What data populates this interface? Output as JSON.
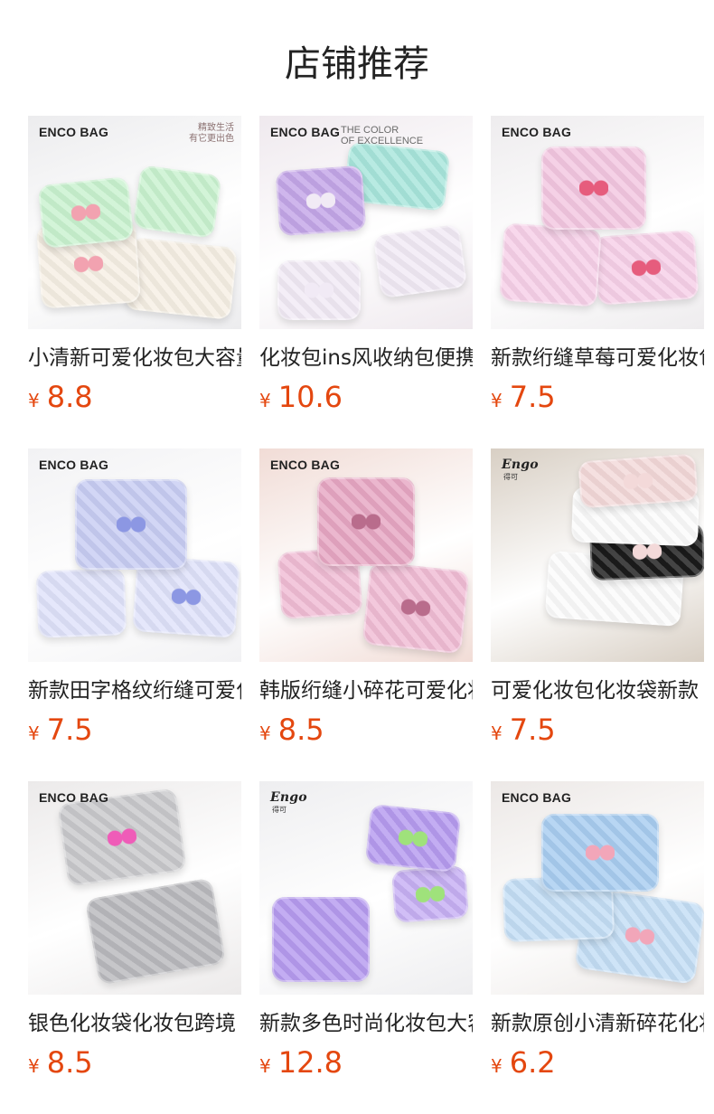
{
  "section_title": "店铺推荐",
  "currency_symbol": "¥",
  "products": [
    {
      "brand": "ENCO BAG",
      "overlay": [
        "精致生活",
        "有它更出色"
      ],
      "name": "小清新可爱化妆包大容量",
      "price": "8.8",
      "palette": {
        "bg": "#ececee",
        "a": "#c9f2cf",
        "b": "#f6efe4",
        "accent": "#f2a2b0",
        "accent2": "#9fb8e8"
      }
    },
    {
      "brand": "ENCO BAG",
      "overlay": [
        "THE COLOR",
        "OF EXCELLENCE"
      ],
      "name": "化妆包ins风收纳包便携",
      "price": "10.6",
      "palette": {
        "bg": "#efe9ee",
        "a": "#c4a6e8",
        "b": "#a8e6dc",
        "accent": "#f1eaf5",
        "accent2": "#f06c9a"
      }
    },
    {
      "brand": "ENCO BAG",
      "overlay": [],
      "name": "新款绗缝草莓可爱化妆包",
      "price": "7.5",
      "palette": {
        "bg": "#eeecee",
        "a": "#f3c7e1",
        "b": "#f7d0e8",
        "accent": "#e65c7d",
        "accent2": "#d8c7a0"
      }
    },
    {
      "brand": "ENCO BAG",
      "overlay": [],
      "name": "新款田字格纹绗缝可爱化妆包",
      "price": "7.5",
      "palette": {
        "bg": "#f2f2f4",
        "a": "#c8cdf3",
        "b": "#dfe2fa",
        "accent": "#8c97e3",
        "accent2": "#f0e6d4"
      }
    },
    {
      "brand": "ENCO BAG",
      "overlay": [],
      "name": "韩版绗缝小碎花可爱化妆包",
      "price": "8.5",
      "palette": {
        "bg": "#f1dcd6",
        "a": "#e7a7c3",
        "b": "#f0bcd4",
        "accent": "#b96c8c",
        "accent2": "#e8d2c4"
      }
    },
    {
      "brand": "Engo",
      "overlay": [
        "得可"
      ],
      "name": "可爱化妆包化妆袋新款",
      "price": "7.5",
      "palette": {
        "bg": "#d8cfc4",
        "a": "#fbfbfb",
        "b": "#1b1b1b",
        "accent": "#f3d9d9",
        "accent2": "#e7e2d6"
      }
    },
    {
      "brand": "ENCO BAG",
      "overlay": [],
      "name": "银色化妆袋化妆包跨境",
      "price": "8.5",
      "palette": {
        "bg": "#eceaea",
        "a": "#c9c9cc",
        "b": "#b9b9bd",
        "accent": "#ef5cb8",
        "accent2": "#c8f52f"
      }
    },
    {
      "brand": "Engo",
      "overlay": [
        "得可"
      ],
      "name": "新款多色时尚化妆包大容量",
      "price": "12.8",
      "palette": {
        "bg": "#eeeef0",
        "a": "#b69bef",
        "b": "#c7b0f4",
        "accent": "#9fe27b",
        "accent2": "#f0a99a"
      }
    },
    {
      "brand": "ENCO BAG",
      "overlay": [],
      "name": "新款原创小清新碎花化妆包",
      "price": "6.2",
      "palette": {
        "bg": "#ece8e6",
        "a": "#a9cdf0",
        "b": "#c4def5",
        "accent": "#f2a6b9",
        "accent2": "#e8c4a6"
      }
    }
  ]
}
